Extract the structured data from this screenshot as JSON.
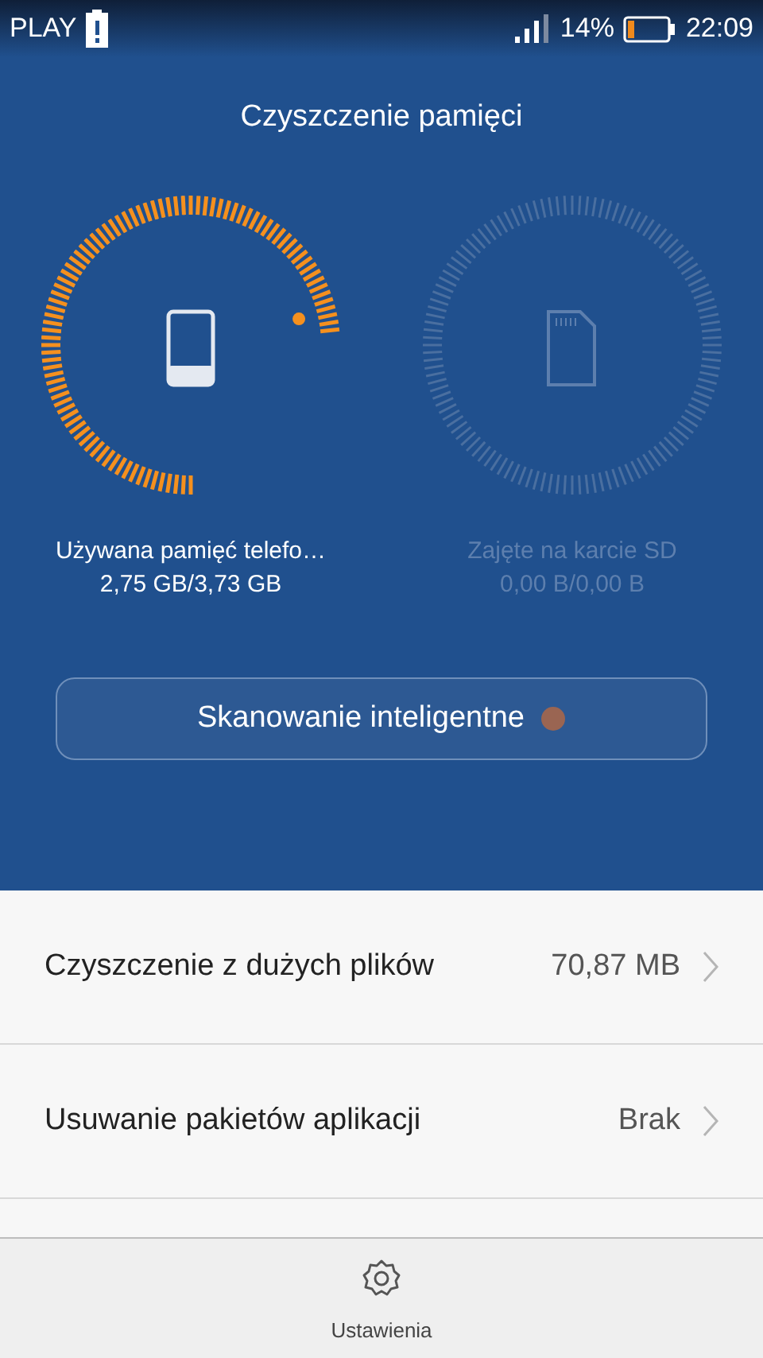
{
  "status_bar": {
    "carrier": "PLAY",
    "battery_percent": "14%",
    "time": "22:09"
  },
  "title": "Czyszczenie pamięci",
  "gauges": [
    {
      "kind": "phone",
      "label": "Używana pamięć telefo…",
      "value": "2,75 GB/3,73 GB",
      "disabled": false
    },
    {
      "kind": "sd",
      "label": "Zajęte na karcie SD",
      "value": "0,00 B/0,00 B",
      "disabled": true
    }
  ],
  "scan_button": {
    "label": "Skanowanie inteligentne"
  },
  "items": [
    {
      "label": "Czyszczenie z dużych plików",
      "value": "70,87 MB"
    },
    {
      "label": "Usuwanie pakietów aplikacji",
      "value": "Brak"
    }
  ],
  "bottom_bar": {
    "label": "Ustawienia"
  }
}
